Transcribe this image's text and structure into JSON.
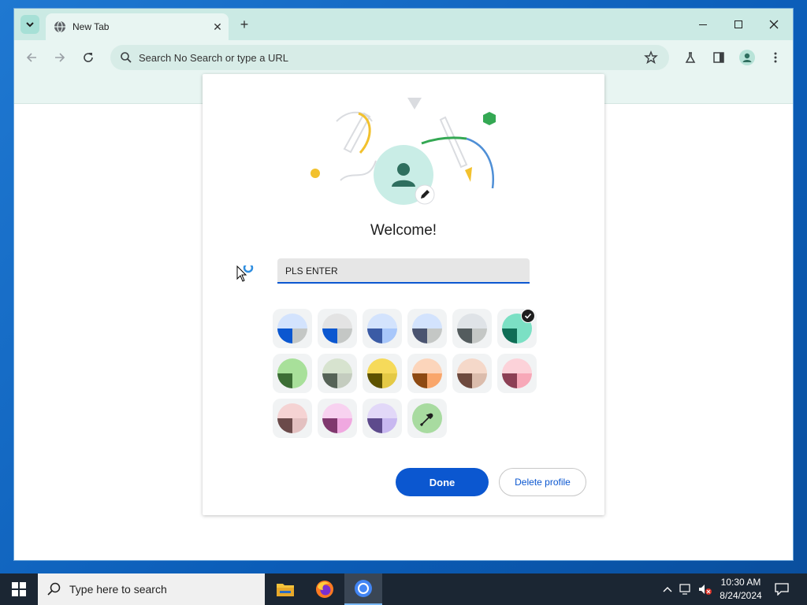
{
  "browser": {
    "tab_title": "New Tab",
    "omnibox_placeholder": "Search No Search or type a URL",
    "accent": "#cbeae4"
  },
  "dialog": {
    "welcome": "Welcome!",
    "name_value": "PLS ENTER",
    "done_label": "Done",
    "delete_label": "Delete profile",
    "selected_color_index": 5,
    "colors": [
      {
        "top": "#d3e3fd",
        "left": "#0b57d0",
        "right": "#c4c7c5"
      },
      {
        "top": "#e3e3e3",
        "left": "#0b57d0",
        "right": "#c4c7c5"
      },
      {
        "top": "#d3e3fd",
        "left": "#3b5ba5",
        "right": "#a8c7fa"
      },
      {
        "top": "#d3e3fd",
        "left": "#4a5470",
        "right": "#c4c7c5"
      },
      {
        "top": "#dfe3e7",
        "left": "#545c5e",
        "right": "#c4c7c5"
      },
      {
        "top": "#7be0c4",
        "left": "#0f6e56",
        "right": "#7be0c4"
      },
      {
        "top": "#a8e09a",
        "left": "#3c6e35",
        "right": "#a8e09a"
      },
      {
        "top": "#d7e3cf",
        "left": "#566357",
        "right": "#c4ccbf"
      },
      {
        "top": "#f6da5a",
        "left": "#5e5300",
        "right": "#e4c945"
      },
      {
        "top": "#fcd5bb",
        "left": "#8e4a13",
        "right": "#f9a66b"
      },
      {
        "top": "#f5d8c9",
        "left": "#6e4a3e",
        "right": "#dbbcac"
      },
      {
        "top": "#fcd2d9",
        "left": "#8c4055",
        "right": "#f7a8b8"
      },
      {
        "top": "#f5d3d3",
        "left": "#6b4a4a",
        "right": "#e3c0c0"
      },
      {
        "top": "#f8d2f0",
        "left": "#80386e",
        "right": "#f0a8e0"
      },
      {
        "top": "#e2d8f8",
        "left": "#5d4a8c",
        "right": "#c8b8f0"
      }
    ],
    "custom_color_icon": "eyedropper-icon",
    "primary_color": "#0b57d0"
  },
  "taskbar": {
    "search_placeholder": "Type here to search",
    "time": "10:30 AM",
    "date": "8/24/2024"
  }
}
